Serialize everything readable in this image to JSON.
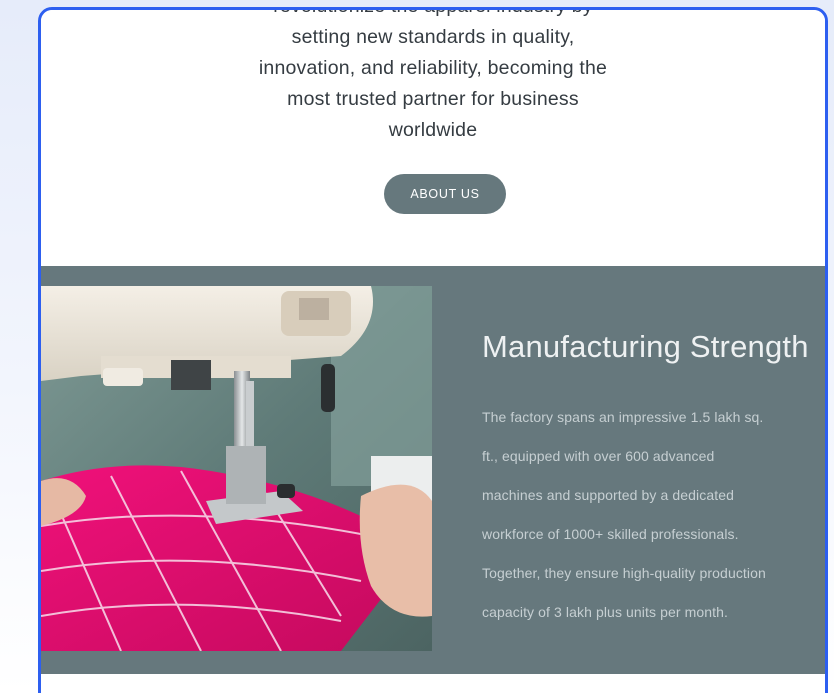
{
  "hero": {
    "mission_lines": [
      "revolutionize the apparel industry by",
      "setting new standards in quality,",
      "innovation, and reliability, becoming the",
      "most trusted partner for business",
      "worldwide"
    ],
    "about_button": "ABOUT US"
  },
  "strength": {
    "heading": "Manufacturing Strength",
    "paragraph_lines": [
      "The factory spans an impressive 1.5 lakh sq.",
      "ft., equipped with over 600 advanced",
      "machines and supported by a dedicated",
      "workforce of 1000+ skilled professionals.",
      "Together, they ensure high-quality production",
      "capacity of 3 lakh plus units per month."
    ],
    "image_subject": "sewing-machine-stitching-pink-fabric"
  },
  "colors": {
    "frame_border": "#2d5ff0",
    "section_bg": "#66787d",
    "button_bg": "#66787d",
    "heading_text": "#eef1f2",
    "paragraph_text": "#c6cfd2",
    "mission_text": "#353c42"
  }
}
